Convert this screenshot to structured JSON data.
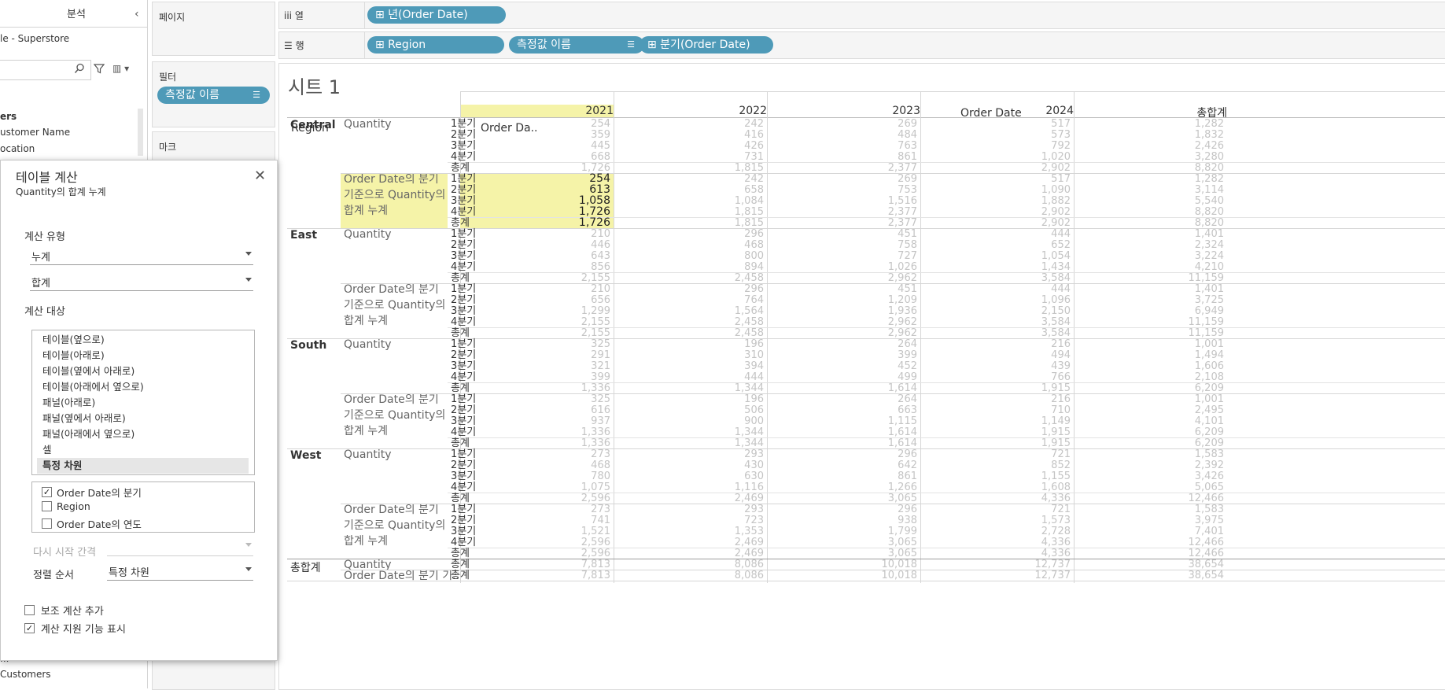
{
  "data_pane": {
    "tab_analysis": "분석",
    "datasource": "le - Superstore",
    "section_header": "ers",
    "fields_top": [
      "ustomer Name",
      "ocation"
    ],
    "fields_bottom": [
      "...",
      "Customers"
    ]
  },
  "shelves": {
    "pages_title": "페이지",
    "filters_title": "필터",
    "filter_pill": "측정값 이름",
    "marks_title": "마크",
    "columns_label": "열",
    "rows_label": "행",
    "column_pills": [
      "⊞ 년(Order Date)"
    ],
    "row_pills": [
      "⊞ Region",
      "측정값 이름",
      "⊞ 분기(Order Date)"
    ]
  },
  "view": {
    "sheet_title": "시트 1",
    "column_group": "Order Date",
    "row_headers": [
      "Region",
      "Order Da.."
    ],
    "years": [
      "2021",
      "2022",
      "2023",
      "2024",
      "총합계"
    ],
    "quarters": [
      "1분기",
      "2분기",
      "3분기",
      "4분기",
      "총계"
    ],
    "measure_quantity": "Quantity",
    "measure_running": "Order Date의 분기 기준으로 Quantity의 합계 누계",
    "measure_running_lines": [
      "Order Date의 분기",
      "기준으로 Quantity의",
      "합계 누계"
    ],
    "regions": [
      {
        "name": "Central",
        "quantity": [
          [
            "254",
            "242",
            "269",
            "517",
            "1,282"
          ],
          [
            "359",
            "416",
            "484",
            "573",
            "1,832"
          ],
          [
            "445",
            "426",
            "763",
            "792",
            "2,426"
          ],
          [
            "668",
            "731",
            "861",
            "1,020",
            "3,280"
          ],
          [
            "1,726",
            "1,815",
            "2,377",
            "2,902",
            "8,820"
          ]
        ],
        "running": [
          [
            "254",
            "242",
            "269",
            "517",
            "1,282"
          ],
          [
            "613",
            "658",
            "753",
            "1,090",
            "3,114"
          ],
          [
            "1,058",
            "1,084",
            "1,516",
            "1,882",
            "5,540"
          ],
          [
            "1,726",
            "1,815",
            "2,377",
            "2,902",
            "8,820"
          ],
          [
            "1,726",
            "1,815",
            "2,377",
            "2,902",
            "8,820"
          ]
        ]
      },
      {
        "name": "East",
        "quantity": [
          [
            "210",
            "296",
            "451",
            "444",
            "1,401"
          ],
          [
            "446",
            "468",
            "758",
            "652",
            "2,324"
          ],
          [
            "643",
            "800",
            "727",
            "1,054",
            "3,224"
          ],
          [
            "856",
            "894",
            "1,026",
            "1,434",
            "4,210"
          ],
          [
            "2,155",
            "2,458",
            "2,962",
            "3,584",
            "11,159"
          ]
        ],
        "running": [
          [
            "210",
            "296",
            "451",
            "444",
            "1,401"
          ],
          [
            "656",
            "764",
            "1,209",
            "1,096",
            "3,725"
          ],
          [
            "1,299",
            "1,564",
            "1,936",
            "2,150",
            "6,949"
          ],
          [
            "2,155",
            "2,458",
            "2,962",
            "3,584",
            "11,159"
          ],
          [
            "2,155",
            "2,458",
            "2,962",
            "3,584",
            "11,159"
          ]
        ]
      },
      {
        "name": "South",
        "quantity": [
          [
            "325",
            "196",
            "264",
            "216",
            "1,001"
          ],
          [
            "291",
            "310",
            "399",
            "494",
            "1,494"
          ],
          [
            "321",
            "394",
            "452",
            "439",
            "1,606"
          ],
          [
            "399",
            "444",
            "499",
            "766",
            "2,108"
          ],
          [
            "1,336",
            "1,344",
            "1,614",
            "1,915",
            "6,209"
          ]
        ],
        "running": [
          [
            "325",
            "196",
            "264",
            "216",
            "1,001"
          ],
          [
            "616",
            "506",
            "663",
            "710",
            "2,495"
          ],
          [
            "937",
            "900",
            "1,115",
            "1,149",
            "4,101"
          ],
          [
            "1,336",
            "1,344",
            "1,614",
            "1,915",
            "6,209"
          ],
          [
            "1,336",
            "1,344",
            "1,614",
            "1,915",
            "6,209"
          ]
        ]
      },
      {
        "name": "West",
        "quantity": [
          [
            "273",
            "293",
            "296",
            "721",
            "1,583"
          ],
          [
            "468",
            "430",
            "642",
            "852",
            "2,392"
          ],
          [
            "780",
            "630",
            "861",
            "1,155",
            "3,426"
          ],
          [
            "1,075",
            "1,116",
            "1,266",
            "1,608",
            "5,065"
          ],
          [
            "2,596",
            "2,469",
            "3,065",
            "4,336",
            "12,466"
          ]
        ],
        "running": [
          [
            "273",
            "293",
            "296",
            "721",
            "1,583"
          ],
          [
            "741",
            "723",
            "938",
            "1,573",
            "3,975"
          ],
          [
            "1,521",
            "1,353",
            "1,799",
            "2,728",
            "7,401"
          ],
          [
            "2,596",
            "2,469",
            "3,065",
            "4,336",
            "12,466"
          ],
          [
            "2,596",
            "2,469",
            "3,065",
            "4,336",
            "12,466"
          ]
        ]
      }
    ],
    "grand_total": {
      "label": "총합계",
      "quantity_label": "Quantity",
      "running_label": "Order Date의 분기 기..",
      "quarter_label": "총계",
      "quantity": [
        "7,813",
        "8,086",
        "10,018",
        "12,737",
        "38,654"
      ],
      "running": [
        "7,813",
        "8,086",
        "10,018",
        "12,737",
        "38,654"
      ]
    },
    "highlight_color": "#f5f3a8"
  },
  "dialog": {
    "title": "테이블 계산",
    "subtitle": "Quantity의 합계 누계",
    "calc_type_label": "계산 유형",
    "calc_type_value": "누계",
    "aggregation_value": "합계",
    "compute_using_label": "계산 대상",
    "compute_options": [
      "테이블(옆으로)",
      "테이블(아래로)",
      "테이블(옆에서 아래로)",
      "테이블(아래에서 옆으로)",
      "패널(아래로)",
      "패널(옆에서 아래로)",
      "패널(아래에서 옆으로)",
      "셀",
      "특정 차원"
    ],
    "selected_option": "특정 차원",
    "dimensions": [
      {
        "label": "Order Date의 분기",
        "checked": true
      },
      {
        "label": "Region",
        "checked": false
      },
      {
        "label": "Order Date의 연도",
        "checked": false
      }
    ],
    "restart_label": "다시 시작 간격",
    "sort_label": "정렬 순서",
    "sort_value": "특정 차원",
    "secondary_label": "보조 계산 추가",
    "secondary_checked": false,
    "assist_label": "계산 지원 기능 표시",
    "assist_checked": true
  },
  "colors": {
    "pill": "#4e9ab8",
    "highlight": "#f5f3a8"
  }
}
